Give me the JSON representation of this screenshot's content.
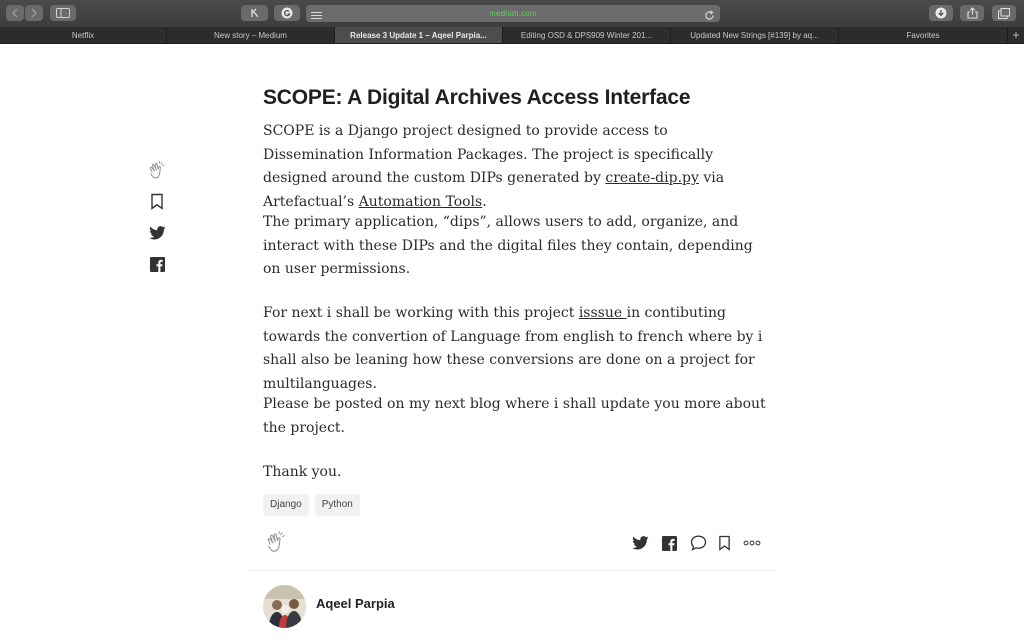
{
  "browser": {
    "address": "medium.com",
    "tabs": [
      {
        "label": "Netflix",
        "active": false
      },
      {
        "label": "New story – Medium",
        "active": false
      },
      {
        "label": "Release 3 Update 1 – Aqeel Parpia...",
        "active": true
      },
      {
        "label": "Editing OSD & DPS909 Winter 201...",
        "active": false
      },
      {
        "label": "Updated New Strings [#139] by aq...",
        "active": false
      },
      {
        "label": "Favorites",
        "active": false
      }
    ],
    "new_tab_label": "+"
  },
  "article": {
    "title": "SCOPE: A Digital Archives Access Interface",
    "p1": {
      "a": "SCOPE is a Django project designed to provide access to Dissemination Information Packages. The project is specifically designed around the custom DIPs generated by ",
      "link1": "create-dip.py",
      "b": " via Artefactual’s ",
      "link2": "Automation Tools",
      "c": "."
    },
    "p2": "The primary application, “dips”, allows users to add, organize, and interact with these DIPs and the digital files they contain, depending on user permissions.",
    "p3": {
      "a": "For next i shall be working with this project ",
      "link": "isssue ",
      "b": "in contibuting towards the convertion of Language from english to french where by i shall also be leaning how these conversions are done on a project for multilanguages."
    },
    "p4": "Please be posted on my next blog where i shall update you more about the project.",
    "p5": "Thank you.",
    "tags": [
      "Django",
      "Python"
    ]
  },
  "author": {
    "name": "Aqeel Parpia"
  },
  "icons": {
    "side": [
      "clap-icon",
      "bookmark-icon",
      "twitter-icon",
      "facebook-icon"
    ],
    "actions": [
      "clap-icon",
      "twitter-icon",
      "facebook-icon",
      "comment-icon",
      "bookmark-icon",
      "more-icon"
    ]
  },
  "colors": {
    "address_text": "#5ed35e",
    "toolbar": "#3d3d3d",
    "active_tab": "#4d4d4d",
    "text": "#2b2b2b"
  }
}
